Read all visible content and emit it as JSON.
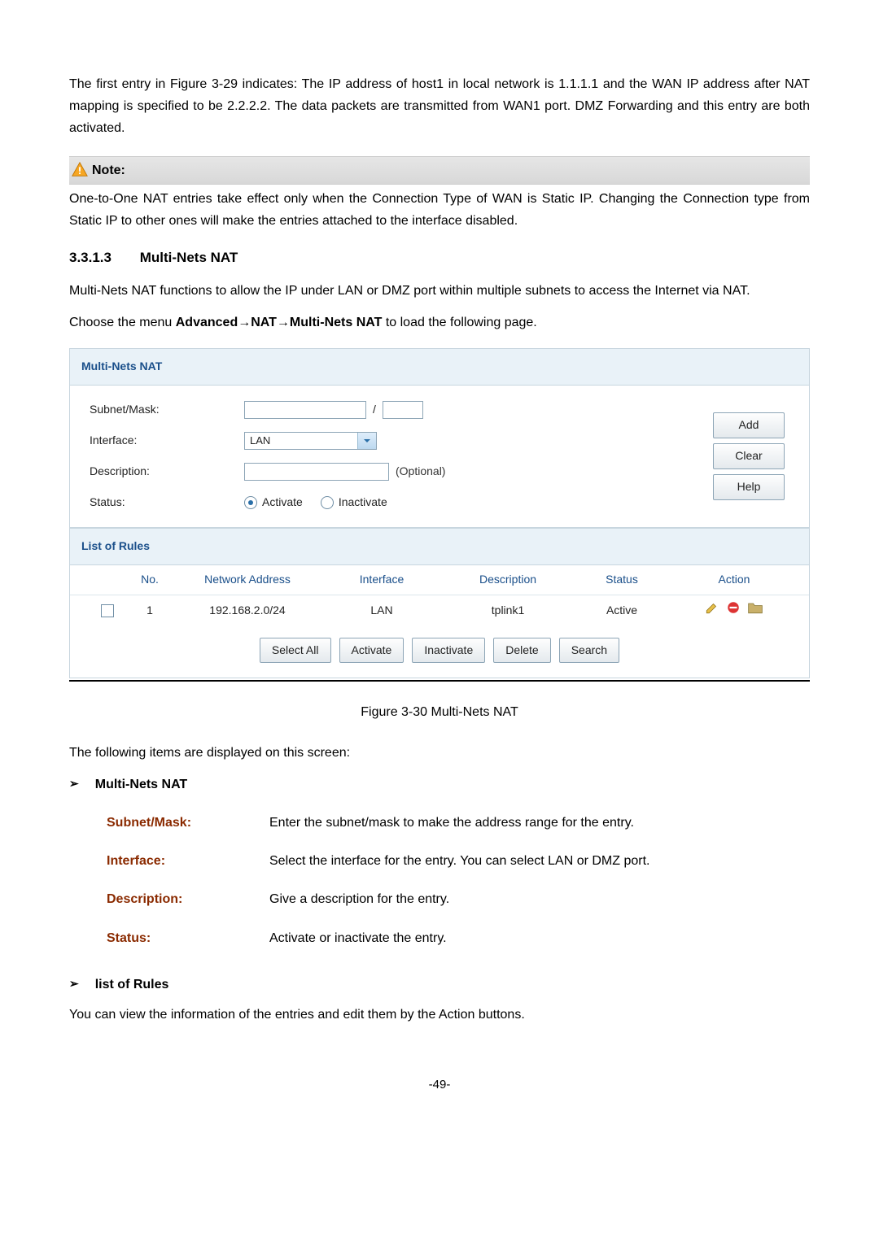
{
  "intro_para": "The first entry in Figure 3-29 indicates: The IP address of host1 in local network is 1.1.1.1 and the WAN IP address after NAT mapping is specified to be 2.2.2.2. The data packets are transmitted from WAN1 port. DMZ Forwarding and this entry are both activated.",
  "note_label": "Note:",
  "note_body": "One-to-One NAT entries take effect only when the Connection Type of WAN is Static IP. Changing the Connection type from Static IP to other ones will make the entries attached to the interface disabled.",
  "section_number": "3.3.1.3",
  "section_title": "Multi-Nets NAT",
  "section_desc": "Multi-Nets NAT functions to allow the IP under LAN or DMZ port within multiple subnets to access the Internet via NAT.",
  "menu_prefix": "Choose the menu ",
  "menu_path1": "Advanced",
  "menu_arrow": "→",
  "menu_path2": "NAT",
  "menu_path3": "Multi-Nets NAT",
  "menu_suffix": " to load the following page.",
  "panel": {
    "header": "Multi-Nets NAT",
    "subnet_label": "Subnet/Mask:",
    "interface_label": "Interface:",
    "interface_value": "LAN",
    "desc_label": "Description:",
    "desc_hint": "(Optional)",
    "status_label": "Status:",
    "status_activate": "Activate",
    "status_inactivate": "Inactivate",
    "btn_add": "Add",
    "btn_clear": "Clear",
    "btn_help": "Help",
    "rules_header": "List of Rules",
    "cols": {
      "no": "No.",
      "net": "Network Address",
      "iface": "Interface",
      "desc": "Description",
      "status": "Status",
      "action": "Action"
    },
    "row": {
      "no": "1",
      "net": "192.168.2.0/24",
      "iface": "LAN",
      "desc": "tplink1",
      "status": "Active"
    },
    "bar": {
      "select_all": "Select All",
      "activate": "Activate",
      "inactivate": "Inactivate",
      "delete": "Delete",
      "search": "Search"
    }
  },
  "figure_caption": "Figure 3-30 Multi-Nets NAT",
  "items_intro": "The following items are displayed on this screen:",
  "sub1": "Multi-Nets NAT",
  "defs": {
    "subnet_term": "Subnet/Mask:",
    "subnet_desc": "Enter the subnet/mask to make the address range for the entry.",
    "iface_term": "Interface:",
    "iface_desc": "Select the interface for the entry. You can select LAN or DMZ port.",
    "desc_term": "Description:",
    "desc_desc": "Give a description for the entry.",
    "status_term": "Status:",
    "status_desc": "Activate or inactivate the entry."
  },
  "sub2": "list of Rules",
  "rules_body": "You can view the information of the entries and edit them by the Action buttons.",
  "page_number": "-49-"
}
